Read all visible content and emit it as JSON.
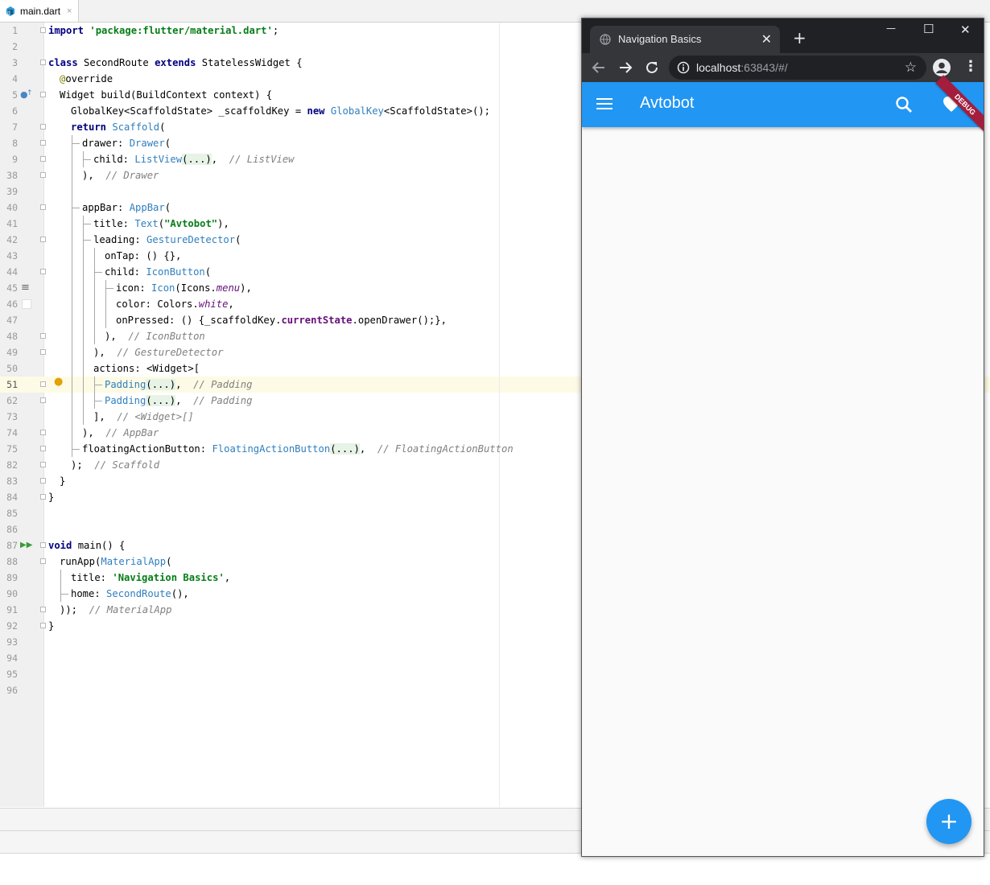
{
  "ide": {
    "file_tab": {
      "name": "main.dart",
      "close": "×"
    },
    "highlighted_line": 51,
    "lines": [
      {
        "n": "1"
      },
      {
        "n": "2"
      },
      {
        "n": "3"
      },
      {
        "n": "4"
      },
      {
        "n": "5"
      },
      {
        "n": "6"
      },
      {
        "n": "7"
      },
      {
        "n": "8"
      },
      {
        "n": "9"
      },
      {
        "n": "38"
      },
      {
        "n": "39"
      },
      {
        "n": "40"
      },
      {
        "n": "41"
      },
      {
        "n": "42"
      },
      {
        "n": "43"
      },
      {
        "n": "44"
      },
      {
        "n": "45"
      },
      {
        "n": "46"
      },
      {
        "n": "47"
      },
      {
        "n": "48"
      },
      {
        "n": "49"
      },
      {
        "n": "50"
      },
      {
        "n": "51"
      },
      {
        "n": "62"
      },
      {
        "n": "73"
      },
      {
        "n": "74"
      },
      {
        "n": "75"
      },
      {
        "n": "82"
      },
      {
        "n": "83"
      },
      {
        "n": "84"
      },
      {
        "n": "85"
      },
      {
        "n": "86"
      },
      {
        "n": "87"
      },
      {
        "n": "88"
      },
      {
        "n": "89"
      },
      {
        "n": "90"
      },
      {
        "n": "91"
      },
      {
        "n": "92"
      },
      {
        "n": "93"
      },
      {
        "n": "94"
      },
      {
        "n": "95"
      },
      {
        "n": "96"
      }
    ],
    "code": {
      "l1": [
        "import",
        " ",
        "'package:flutter/material.dart'",
        ";"
      ],
      "l3": [
        "class",
        " SecondRoute ",
        "extends",
        " StatelessWidget {"
      ],
      "l4": [
        "@",
        "override"
      ],
      "l5": "Widget build(BuildContext context) {",
      "l6": [
        "GlobalKey<ScaffoldState> _scaffoldKey = ",
        "new",
        " ",
        "GlobalKey",
        "<ScaffoldState>();"
      ],
      "l7": [
        "return",
        " ",
        "Scaffold",
        "("
      ],
      "l8": [
        "drawer: ",
        "Drawer",
        "("
      ],
      "l9": [
        "child: ",
        "ListView",
        "(...)",
        ",  ",
        "// ListView"
      ],
      "l38": [
        "),  ",
        "// Drawer"
      ],
      "l40": [
        "appBar: ",
        "AppBar",
        "("
      ],
      "l41": [
        "title: ",
        "Text",
        "(",
        "\"Avtobot\"",
        "),"
      ],
      "l42": [
        "leading: ",
        "GestureDetector",
        "("
      ],
      "l43": "onTap: () {},",
      "l44": [
        "child: ",
        "IconButton",
        "("
      ],
      "l45": [
        "icon: ",
        "Icon",
        "(Icons.",
        "menu",
        "),"
      ],
      "l46": [
        "color: Colors.",
        "white",
        ","
      ],
      "l47": [
        "onPressed: () {_scaffoldKey.",
        "currentState",
        ".openDrawer();},"
      ],
      "l48": [
        "),  ",
        "// IconButton"
      ],
      "l49": [
        "),  ",
        "// GestureDetector"
      ],
      "l50": "actions: <Widget>[",
      "l51": [
        "Padding",
        "(...)",
        ",  ",
        "// Padding"
      ],
      "l62": [
        "Padding",
        "(...)",
        ",  ",
        "// Padding"
      ],
      "l73": [
        "],  ",
        "// <Widget>[]"
      ],
      "l74": [
        "),  ",
        "// AppBar"
      ],
      "l75": [
        "floatingActionButton: ",
        "FloatingActionButton",
        "(...)",
        ",  ",
        "// FloatingActionButton"
      ],
      "l82": [
        ");  ",
        "// Scaffold"
      ],
      "l83": "}",
      "l84": "}",
      "l87": [
        "void",
        " main() {"
      ],
      "l88": [
        "runApp(",
        "MaterialApp",
        "("
      ],
      "l89": [
        "title: ",
        "'Navigation Basics'",
        ","
      ],
      "l90": [
        "home: ",
        "SecondRoute",
        "(),"
      ],
      "l91": [
        "));  ",
        "// MaterialApp"
      ],
      "l92": "}"
    }
  },
  "browser": {
    "tab_title": "Navigation Basics",
    "tab_close": "✕",
    "new_tab": "+",
    "window_minimize": "—",
    "window_maximize": "☐",
    "window_close": "✕",
    "url_host": "localhost",
    "url_path": ":63843/#/",
    "app": {
      "title": "Avtobot",
      "debug_banner": "DEBUG",
      "fab_icon": "+",
      "primary_color": "#2196f3",
      "debug_color": "#a51d3c",
      "icons": [
        "menu-icon",
        "search-icon",
        "heart-icon",
        "add-icon"
      ]
    }
  }
}
